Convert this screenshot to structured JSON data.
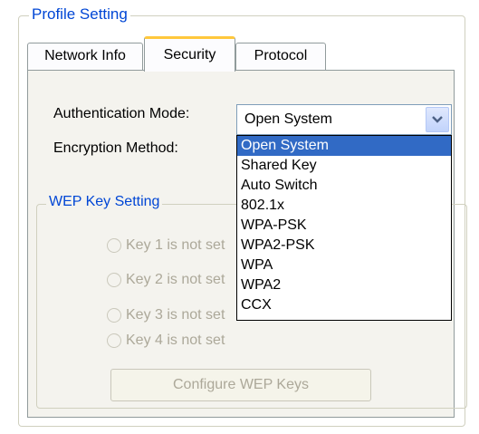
{
  "profile_group": {
    "title": "Profile Setting"
  },
  "tabs": [
    {
      "label": "Network Info",
      "active": false
    },
    {
      "label": "Security",
      "active": true
    },
    {
      "label": "Protocol",
      "active": false
    }
  ],
  "security": {
    "auth_label": "Authentication Mode:",
    "enc_label": "Encryption Method:",
    "auth_value": "Open System",
    "auth_options": [
      "Open System",
      "Shared Key",
      "Auto Switch",
      "802.1x",
      "WPA-PSK",
      "WPA2-PSK",
      "WPA",
      "WPA2",
      "CCX"
    ],
    "selected_index": 0
  },
  "wep": {
    "title": "WEP Key Setting",
    "keys": [
      "Key 1 is not set",
      "Key 2 is not set",
      "Key 3 is not set",
      "Key 4 is not set"
    ],
    "configure_button": "Configure WEP Keys"
  },
  "colors": {
    "group_title": "#0046d5",
    "selection": "#316ac5",
    "disabled_text": "#aca899",
    "active_tab_highlight": "#ffc83c"
  },
  "icons": {
    "combo_arrow": "chevron-down-icon"
  }
}
